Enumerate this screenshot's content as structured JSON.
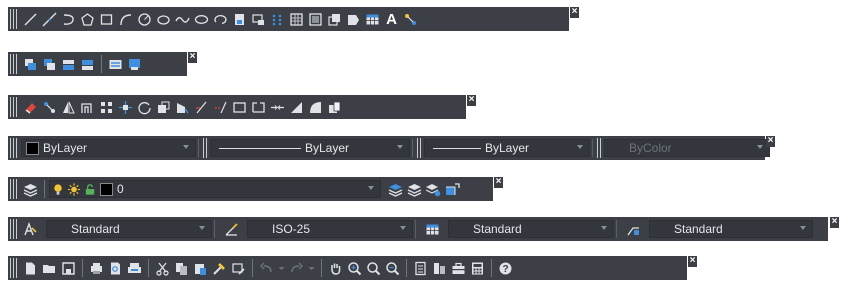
{
  "draw_toolbar": {
    "icons": [
      "line-icon",
      "construction-line-icon",
      "polyline-icon",
      "polygon-icon",
      "rectangle-icon",
      "arc-icon",
      "circle-icon",
      "revision-cloud-icon",
      "spline-icon",
      "ellipse-icon",
      "ellipse-arc-icon",
      "insert-block-icon",
      "make-block-icon",
      "point-icon",
      "hatch-icon",
      "gradient-icon",
      "region-icon",
      "wipeout-icon",
      "table-icon",
      "multiline-text-icon",
      "add-selected-icon"
    ],
    "text_icon_label": "A"
  },
  "draworder_toolbar": {
    "icons": [
      "bring-to-front-icon",
      "send-to-back-icon",
      "bring-above-icon",
      "send-under-icon",
      "text-to-front-icon",
      "hatch-to-back-icon"
    ]
  },
  "modify_toolbar": {
    "icons": [
      "erase-icon",
      "copy-icon",
      "mirror-icon",
      "offset-icon",
      "array-icon",
      "move-icon",
      "rotate-icon",
      "scale-icon",
      "stretch-icon",
      "trim-icon",
      "extend-icon",
      "break-at-point-icon",
      "break-icon",
      "join-icon",
      "chamfer-icon",
      "fillet-icon",
      "explode-icon"
    ]
  },
  "properties_toolbar": {
    "color_value": "ByLayer",
    "linetype_value": "ByLayer",
    "lineweight_value": "ByLayer",
    "plotstyle_value": "ByColor"
  },
  "layers_toolbar": {
    "layer_name": "0"
  },
  "styles_toolbar": {
    "text_style": "Standard",
    "dim_style": "ISO-25",
    "table_style": "Standard",
    "multileader_style": "Standard"
  },
  "standard_toolbar": {
    "icons": [
      "new-icon",
      "open-icon",
      "save-icon",
      "plot-icon",
      "plot-preview-icon",
      "publish-icon",
      "cut-icon",
      "copy-clip-icon",
      "paste-icon",
      "match-properties-icon",
      "block-editor-icon",
      "undo-icon",
      "redo-icon",
      "pan-icon",
      "zoom-realtime-icon",
      "zoom-window-icon",
      "zoom-previous-icon",
      "properties-icon",
      "design-center-icon",
      "tool-palettes-icon",
      "quick-calc-icon",
      "help-icon"
    ]
  },
  "colors": {
    "toolbar_bg": "#3c3f46",
    "icon_blue": "#3f8fe0",
    "icon_light": "#dfe2e6",
    "icon_yellow": "#f3c431"
  }
}
